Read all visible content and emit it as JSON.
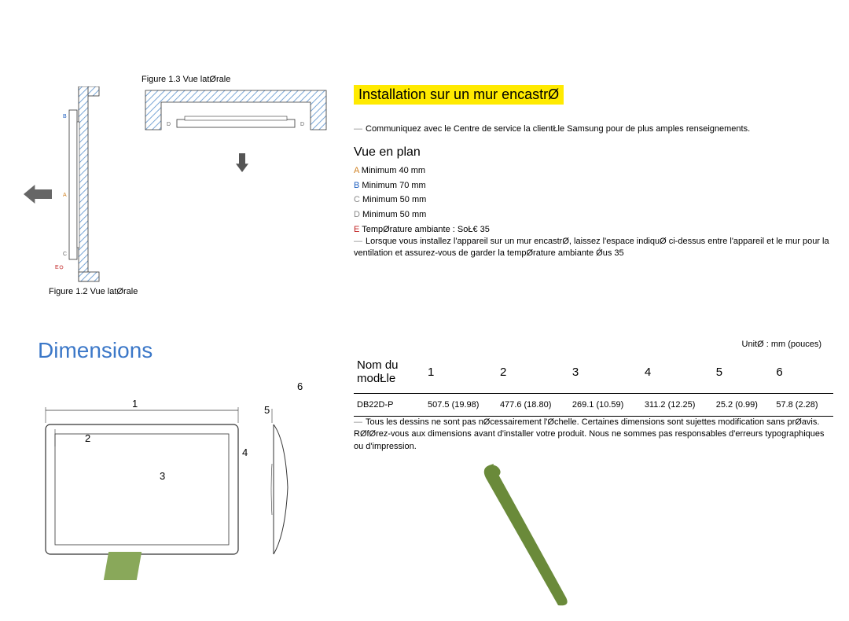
{
  "figures": {
    "fig13_caption": "Figure 1.3 Vue latØrale",
    "fig12_caption": "Figure 1.2 Vue latØrale"
  },
  "headings": {
    "install": "Installation sur un mur encastrØ",
    "plan": "Vue en plan",
    "dimensions": "Dimensions"
  },
  "notes": {
    "contact": "Communiquez avec le Centre de service   la clientŁle Samsung pour de plus amples renseignements.",
    "wall_install": "Lorsque vous installez l'appareil sur un mur encastrØ, laissez l'espace indiquØ ci-dessus entre l'appareil et le mur pour la ventilation et assurez-vous de garder la tempØrature ambiante  Ǿus 35",
    "drawings": "Tous les dessins ne sont pas nØcessairement   l'Øchelle. Certaines dimensions sont sujettes   modification sans prØavis. RØfØrez-vous aux dimensions avant d'installer votre produit. Nous ne sommes pas responsables d'erreurs typographiques ou d'impression."
  },
  "spec": {
    "a": "Minimum 40 mm",
    "b": "Minimum 70 mm",
    "c": "Minimum 50 mm",
    "d": "Minimum 50 mm",
    "e": "TempØrature ambiante : SoŁ€ 35"
  },
  "labels": {
    "A": "A",
    "B": "B",
    "C": "C",
    "D": "D",
    "E": "E"
  },
  "unit": "UnitØ : mm (pouces)",
  "table": {
    "header": {
      "model": "Nom du modŁle",
      "c1": "1",
      "c2": "2",
      "c3": "3",
      "c4": "4",
      "c5": "5",
      "c6": "6"
    },
    "row1": {
      "model": "DB22D-P",
      "c1": "507.5 (19.98)",
      "c2": "477.6 (18.80)",
      "c3": "269.1 (10.59)",
      "c4": "311.2 (12.25)",
      "c5": "25.2 (0.99)",
      "c6": "57.8 (2.28)"
    }
  },
  "dim_numbers": {
    "n1": "1",
    "n2": "2",
    "n3": "3",
    "n4": "4",
    "n5": "5",
    "n6": "6"
  }
}
